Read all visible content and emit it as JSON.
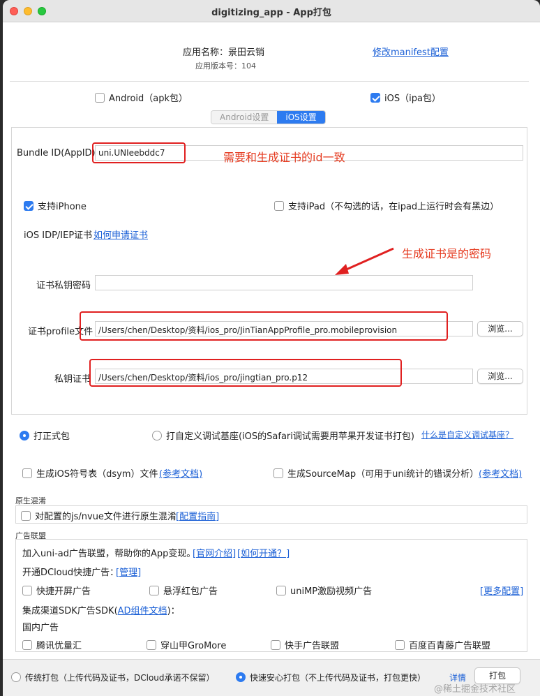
{
  "window": {
    "title": "digitizing_app - App打包"
  },
  "app_info": {
    "name_label": "应用名称：景田云销",
    "version_label": "应用版本号：104",
    "manifest_link": "修改manifest配置"
  },
  "platforms": {
    "android_label": "Android（apk包）",
    "ios_label": "iOS（ipa包）"
  },
  "tabs": {
    "android": "Android设置",
    "ios": "iOS设置"
  },
  "ios": {
    "bundle_label": "Bundle ID(AppID)",
    "bundle_value": "uni.UNIeebddc7",
    "iphone_label": "支持iPhone",
    "ipad_label": "支持iPad（不勾选的话，在ipad上运行时会有黑边）",
    "cert_label": "iOS IDP/IEP证书",
    "cert_link": "如何申请证书",
    "password_label": "证书私钥密码",
    "password_value": "",
    "profile_label": "证书profile文件",
    "profile_value": "/Users/chen/Desktop/资料/ios_pro/JinTianAppProfile_pro.mobileprovision",
    "key_label": "私钥证书",
    "key_value": "/Users/chen/Desktop/资料/ios_pro/jingtian_pro.p12",
    "browse_label": "浏览..."
  },
  "annotations": {
    "bundle_note": "需要和生成证书的id一致",
    "password_note": "生成证书是的密码"
  },
  "pack_mode": {
    "formal_label": "打正式包",
    "custom_label": "打自定义调试基座(iOS的Safari调试需要用苹果开发证书打包)",
    "custom_link": "什么是自定义调试基座？"
  },
  "options": {
    "dsym_label": "生成iOS符号表（dsym）文件",
    "dsym_link": "(参考文档)",
    "sourcemap_label": "生成SourceMap（可用于uni统计的错误分析）",
    "sourcemap_link": "(参考文档)"
  },
  "obfuscation": {
    "section_title": "原生混淆",
    "option_label": "对配置的js/nvue文件进行原生混淆",
    "guide_link": "[配置指南]"
  },
  "ads": {
    "section_title": "广告联盟",
    "intro_text": "加入uni-ad广告联盟，帮助你的App变现。",
    "intro_link1": "[官网介绍]",
    "intro_link2": "[如何开通？]",
    "dcloud_label": "开通DCloud快捷广告：",
    "manage_link": "[管理]",
    "splash_label": "快捷开屏广告",
    "redpack_label": "悬浮红包广告",
    "unimp_label": "uniMP激励视频广告",
    "more_link": "[更多配置]",
    "sdk_label_pre": "集成渠道SDK广告SDK(",
    "sdk_link": "AD组件文档",
    "sdk_label_post": ")：",
    "domestic_label": "国内广告",
    "tencent_label": "腾讯优量汇",
    "pangle_label": "穿山甲GroMore",
    "kuaishou_label": "快手广告联盟",
    "baidu_label": "百度百青藤广告联盟"
  },
  "footer": {
    "traditional_label": "传统打包（上传代码及证书，DCloud承诺不保留）",
    "safe_label": "快速安心打包（不上传代码及证书，打包更快）",
    "detail_link": "详情",
    "pack_button": "打包",
    "watermark": "@稀土掘金技术社区"
  }
}
